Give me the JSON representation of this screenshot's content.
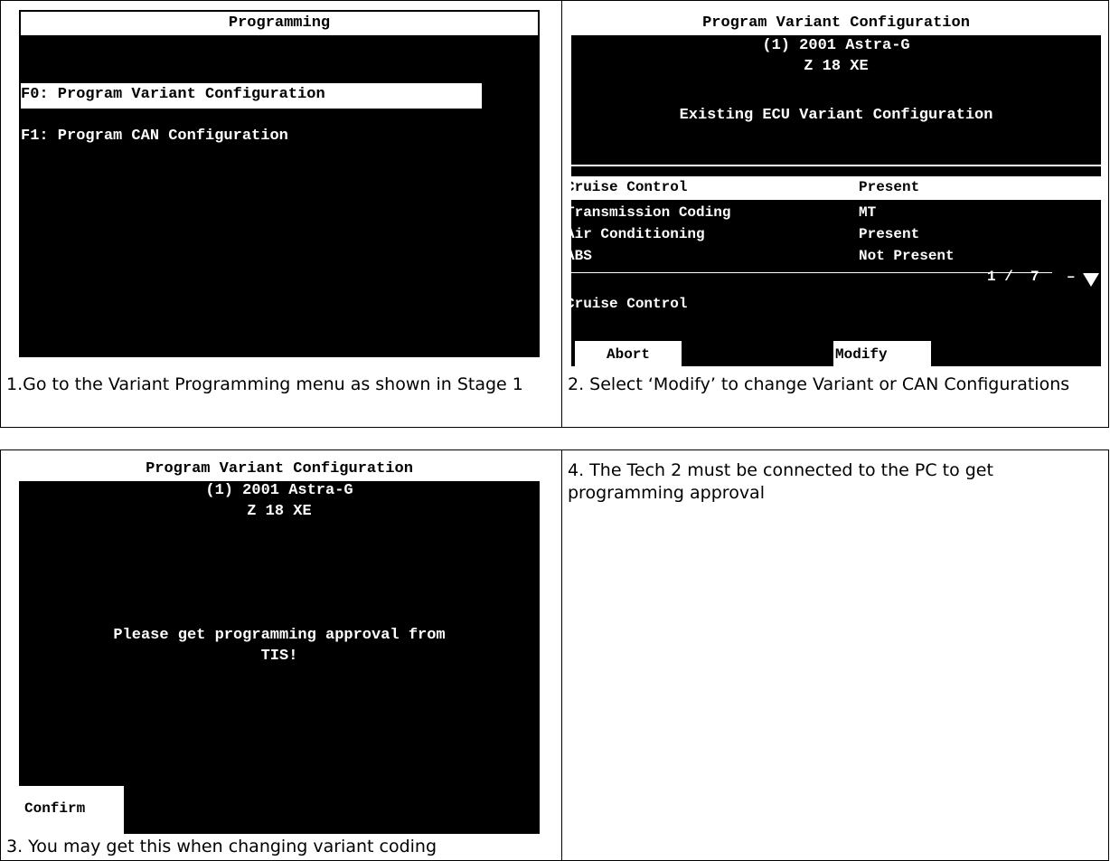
{
  "panel1": {
    "header": "Programming",
    "item_f0": "F0: Program Variant Configuration",
    "item_f1": "F1: Program CAN Configuration",
    "caption": "1.Go to the Variant Programming menu as shown in Stage 1"
  },
  "panel2": {
    "title": "Program Variant Configuration",
    "vehicle": "(1) 2001 Astra-G",
    "engine": "Z 18 XE",
    "subtitle": "Existing ECU Variant Configuration",
    "rows": [
      {
        "label": "Cruise Control",
        "value": "Present"
      },
      {
        "label": "Transmission Coding",
        "value": "MT"
      },
      {
        "label": "Air Conditioning",
        "value": "Present"
      },
      {
        "label": "ABS",
        "value": "Not Present"
      }
    ],
    "page": "1 /  7",
    "selected": "Cruise Control",
    "abort_label": "Abort",
    "modify_label": "Modify",
    "caption": "2. Select ‘Modify’ to change Variant or CAN Configurations"
  },
  "panel3": {
    "title": "Program Variant Configuration",
    "vehicle": "(1) 2001 Astra-G",
    "engine": "Z 18 XE",
    "message_line1": "Please get programming approval from",
    "message_line2": "TIS!",
    "confirm_label": "Confirm",
    "caption": "3. You may get this when changing variant coding"
  },
  "panel4": {
    "caption": "4. The Tech 2 must be connected to the PC to get programming approval"
  }
}
